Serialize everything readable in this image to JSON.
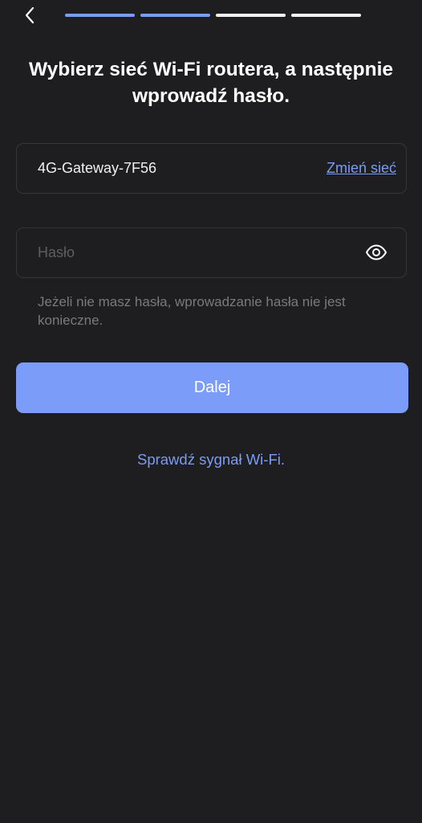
{
  "header": {
    "back_icon": "chevron-left-icon",
    "progress": {
      "total_steps": 4,
      "completed_steps": 2,
      "active_color": "#7b9cf5",
      "inactive_color": "#f2f2f2"
    }
  },
  "main": {
    "title": "Wybierz sieć Wi-Fi routera, a następnie wprowadź hasło.",
    "network": {
      "ssid": "4G-Gateway-7F56",
      "change_label": "Zmień sieć"
    },
    "password": {
      "value": "",
      "placeholder": "Hasło",
      "visibility_icon": "eye-icon"
    },
    "hint": "Jeżeli nie masz hasła, wprowadzanie hasła nie jest konieczne.",
    "next_label": "Dalej",
    "signal_link": "Sprawdź sygnał Wi-Fi."
  },
  "colors": {
    "background": "#1e1e20",
    "accent": "#7b9cf5",
    "button": "#7b9cf8",
    "field_border": "#36363a",
    "muted_text": "#7a7a7e"
  }
}
